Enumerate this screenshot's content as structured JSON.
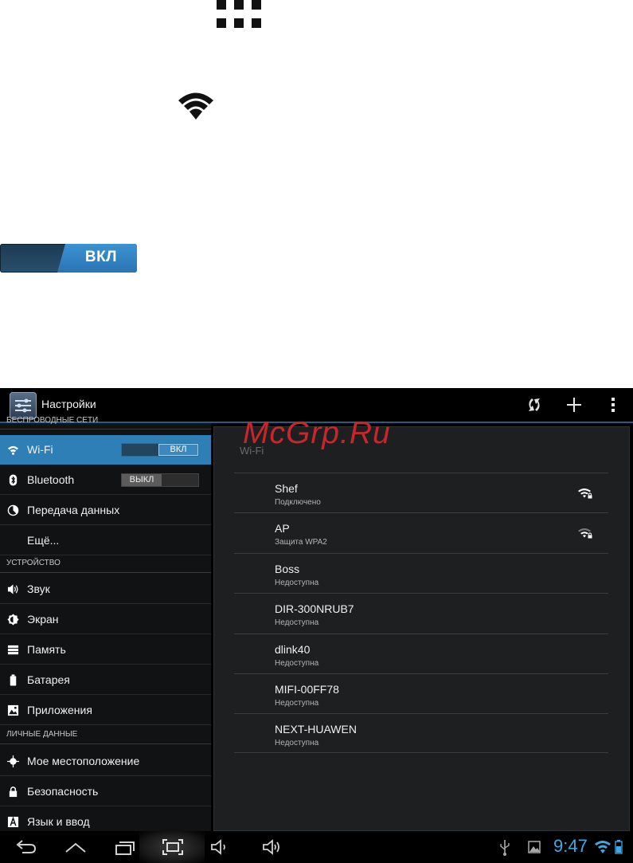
{
  "watermark": "McGrp.Ru",
  "badge": {
    "label": "ВКЛ"
  },
  "actionbar": {
    "title": "Настройки"
  },
  "sections": {
    "wireless": "БЕСПРОВОДНЫЕ СЕТИ",
    "device": "УСТРОЙСТВО",
    "personal": "ЛИЧНЫЕ ДАННЫЕ"
  },
  "menu": {
    "wifi": "Wi-Fi",
    "wifi_toggle": "ВКЛ",
    "bluetooth": "Bluetooth",
    "bluetooth_toggle": "ВЫКЛ",
    "data": "Передача данных",
    "more": "Ещё...",
    "sound": "Звук",
    "display": "Экран",
    "storage": "Память",
    "battery": "Батарея",
    "apps": "Приложения",
    "location": "Мое местоположение",
    "security": "Безопасность",
    "language": "Язык и ввод"
  },
  "panel": {
    "title": "Wi-Fi"
  },
  "networks": [
    {
      "name": "Shef",
      "status": "Подключено"
    },
    {
      "name": "AP",
      "status": "Защита WPA2"
    },
    {
      "name": "Boss",
      "status": "Недоступна"
    },
    {
      "name": "DIR-300NRUB7",
      "status": "Недоступна"
    },
    {
      "name": "dlink40",
      "status": "Недоступна"
    },
    {
      "name": "MIFI-00FF78",
      "status": "Недоступна"
    },
    {
      "name": "NEXT-HUAWEN",
      "status": "Недоступна"
    }
  ],
  "status": {
    "time": "9:47"
  },
  "colors": {
    "accent": "#2f7fb7",
    "clock": "#3fa9e6",
    "watermark": "#c9262c"
  }
}
